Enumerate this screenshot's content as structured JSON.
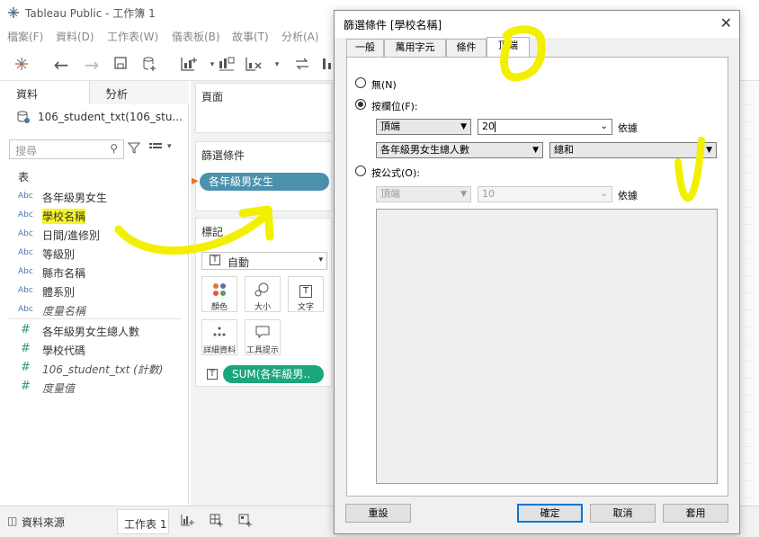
{
  "app": {
    "title": "Tableau Public - 工作簿 1"
  },
  "menu": [
    "檔案(F)",
    "資料(D)",
    "工作表(W)",
    "儀表板(B)",
    "故事(T)",
    "分析(A)"
  ],
  "sidebar": {
    "tab_data": "資料",
    "tab_analysis": "分析",
    "datasource": "106_student_txt(106_stu...",
    "search_placeholder": "搜尋",
    "section_table": "表",
    "dimensions": [
      {
        "type": "Abc",
        "name": "各年級男女生"
      },
      {
        "type": "Abc",
        "name": "學校名稱"
      },
      {
        "type": "Abc",
        "name": "日間/進修別"
      },
      {
        "type": "Abc",
        "name": "等級別"
      },
      {
        "type": "Abc",
        "name": "縣市名稱"
      },
      {
        "type": "Abc",
        "name": "體系別"
      },
      {
        "type": "Abc",
        "name": "度量名稱"
      }
    ],
    "measures": [
      {
        "type": "#",
        "name": "各年級男女生總人數"
      },
      {
        "type": "#",
        "name": "學校代碼"
      },
      {
        "type": "#",
        "name": "106_student_txt (計數)"
      },
      {
        "type": "#",
        "name": "度量值"
      }
    ]
  },
  "shelves": {
    "pages": "頁面",
    "filters": "篩選條件",
    "filter_pill": "各年級男女生",
    "marks": "標記",
    "marks_type": "自動",
    "mark_buttons": [
      "顏色",
      "大小",
      "文字",
      "詳細資料",
      "工具提示"
    ],
    "text_pill": "SUM(各年級男.."
  },
  "bottom": {
    "datasource_tab": "資料來源",
    "sheet_tab": "工作表 1"
  },
  "dialog": {
    "title": "篩選條件 [學校名稱]",
    "tabs": [
      "一般",
      "萬用字元",
      "條件",
      "頂端"
    ],
    "opt_none": "無(N)",
    "opt_byfield": "按欄位(F):",
    "byfield_dir": "頂端",
    "byfield_count": "20",
    "by_label": "依據",
    "byfield_field": "各年級男女生總人數",
    "byfield_agg": "總和",
    "opt_byformula": "按公式(O):",
    "formula_dir": "頂端",
    "formula_count": "10",
    "formula_by": "依據",
    "btn_reset": "重設",
    "btn_ok": "確定",
    "btn_cancel": "取消",
    "btn_apply": "套用"
  },
  "colors": {
    "filter_pill": "#4a91ad",
    "measure_pill": "#1ba67c",
    "highlight": "#f7f52b",
    "annotation": "#f2f000"
  }
}
